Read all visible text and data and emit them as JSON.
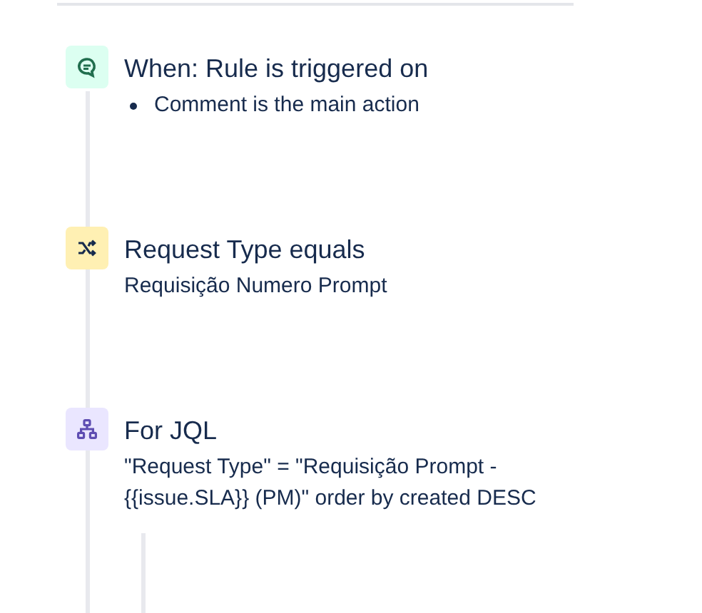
{
  "steps": [
    {
      "kind": "trigger",
      "title": "When: Rule is triggered on",
      "bullets": [
        "Comment is the main action"
      ]
    },
    {
      "kind": "condition",
      "title": "Request Type equals",
      "detail": "Requisição Numero Prompt"
    },
    {
      "kind": "branch",
      "title": "For JQL",
      "detail": "\"Request Type\" = \"Requisição Prompt - {{issue.SLA}} (PM)\" order by created DESC"
    }
  ]
}
